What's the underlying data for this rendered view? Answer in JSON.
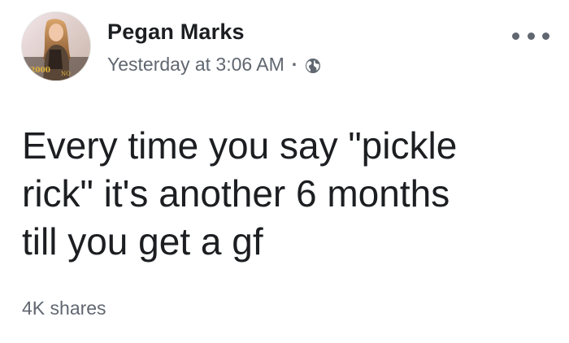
{
  "post": {
    "author_name": "Pegan Marks",
    "timestamp": "Yesterday at 3:06 AM",
    "separator": "·",
    "privacy_icon": "globe-icon",
    "more_icon": "more-options-icon",
    "text_lines": [
      "Every time you say \"pickle",
      "rick\" it's another 6 months",
      "till you get a gf"
    ],
    "shares_label": "4K shares"
  },
  "colors": {
    "primary_text": "#1c1e21",
    "secondary_text": "#606770",
    "background": "#ffffff"
  }
}
